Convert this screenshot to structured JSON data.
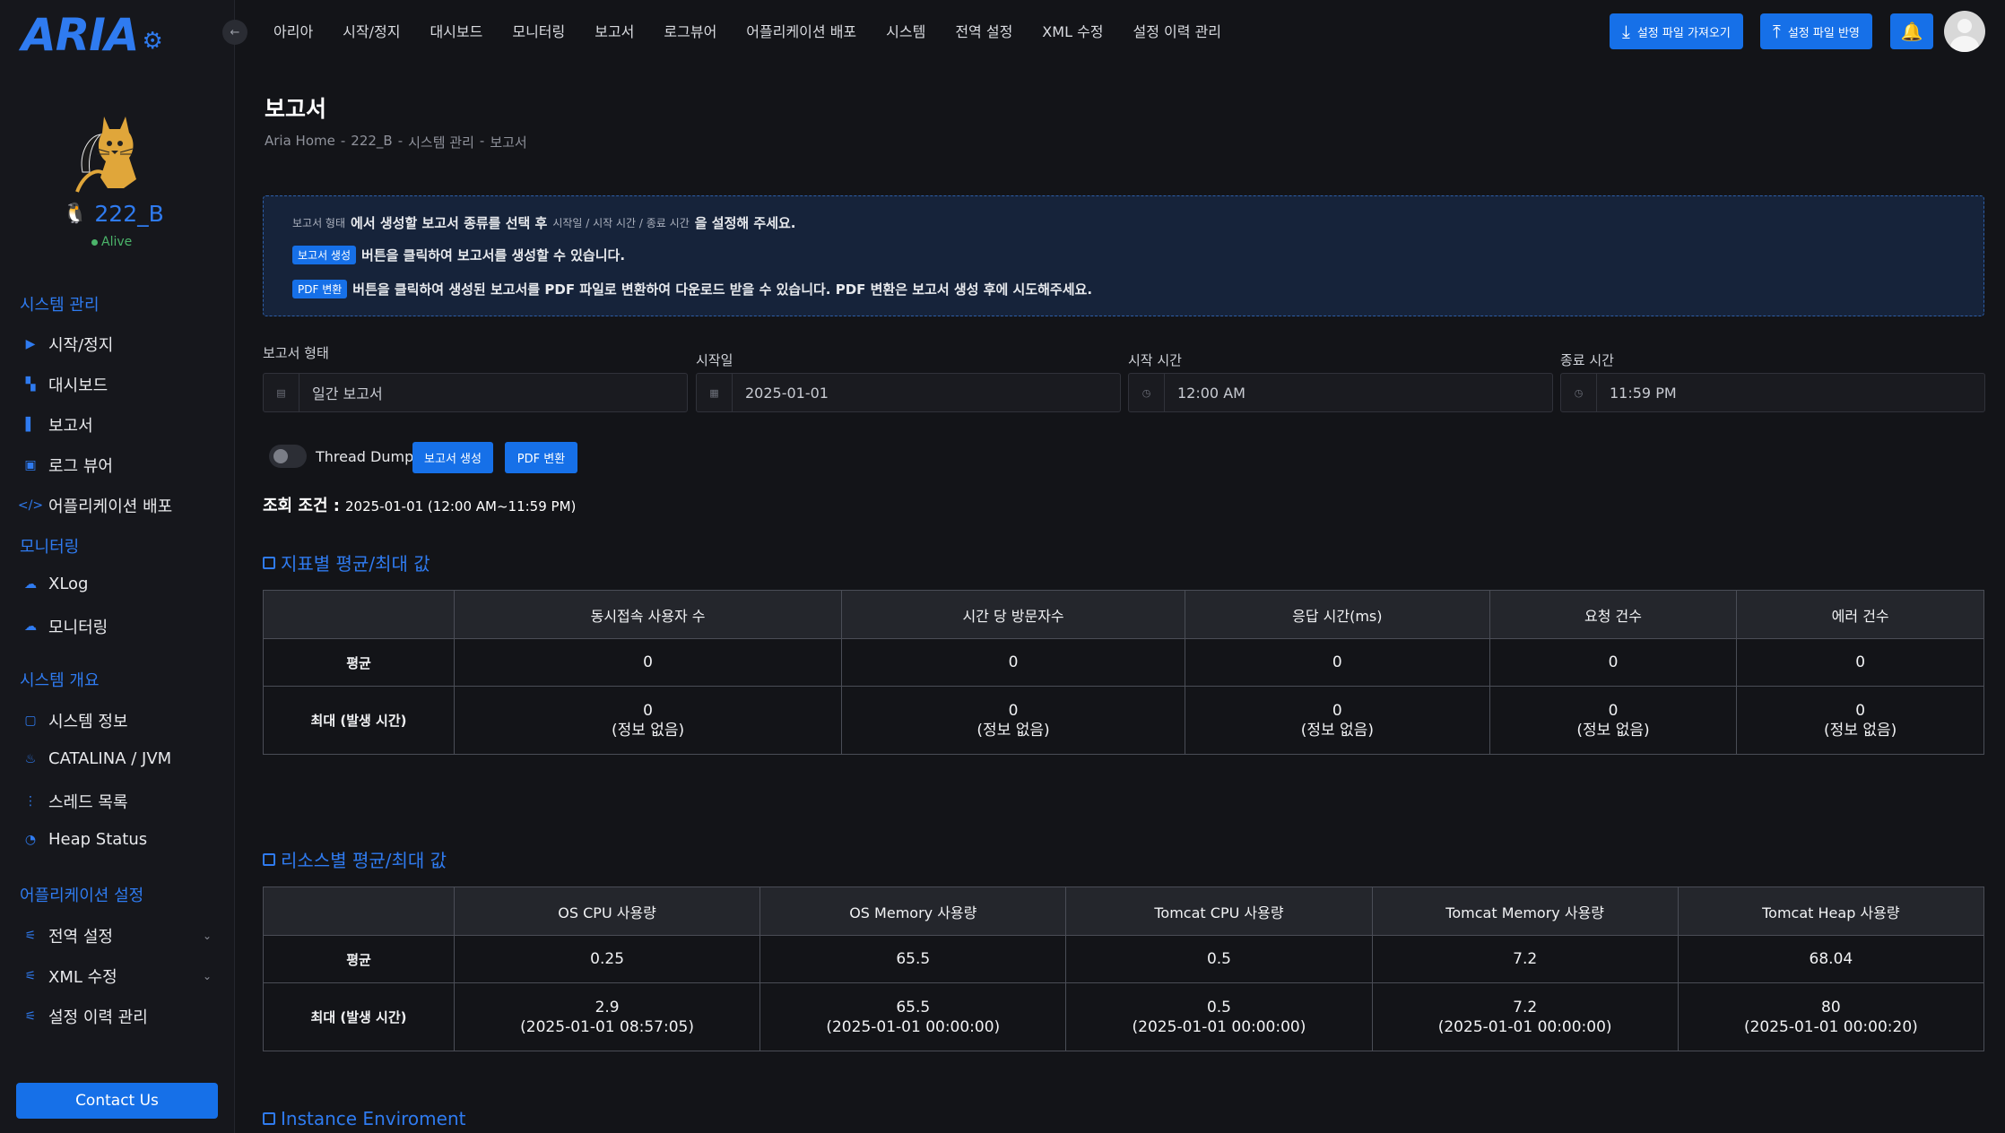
{
  "logo": {
    "text": "ARIA",
    "gear_icon": "gear-icon"
  },
  "instance": {
    "name": "222_B",
    "status": "Alive",
    "os_icon": "linux-penguin-icon"
  },
  "sidebar": {
    "sections": [
      {
        "title": "시스템 관리",
        "items": [
          {
            "label": "시작/정지",
            "icon": "play-icon"
          },
          {
            "label": "대시보드",
            "icon": "dashboard-icon"
          },
          {
            "label": "보고서",
            "icon": "report-icon"
          },
          {
            "label": "로그 뷰어",
            "icon": "log-icon"
          },
          {
            "label": "어플리케이션 배포",
            "icon": "code-icon"
          }
        ]
      },
      {
        "title": "모니터링",
        "items": [
          {
            "label": "XLog",
            "icon": "xlog-icon"
          },
          {
            "label": "모니터링",
            "icon": "monitor-icon"
          }
        ]
      },
      {
        "title": "시스템 개요",
        "items": [
          {
            "label": "시스템 정보",
            "icon": "chip-icon"
          },
          {
            "label": "CATALINA / JVM",
            "icon": "java-icon"
          },
          {
            "label": "스레드 목록",
            "icon": "thread-icon"
          },
          {
            "label": "Heap Status",
            "icon": "pie-icon"
          }
        ]
      },
      {
        "title": "어플리케이션 설정",
        "items": [
          {
            "label": "전역 설정",
            "icon": "sliders-icon"
          },
          {
            "label": "XML 수정",
            "icon": "sliders-icon"
          },
          {
            "label": "설정 이력 관리",
            "icon": "sliders-icon"
          }
        ]
      }
    ],
    "contact_label": "Contact Us"
  },
  "topnav": {
    "items": [
      "아리아",
      "시작/정지",
      "대시보드",
      "모니터링",
      "보고서",
      "로그뷰어",
      "어플리케이션 배포",
      "시스템",
      "전역 설정",
      "XML 수정",
      "설정 이력 관리"
    ],
    "import_label": "설정 파일 가져오기",
    "apply_label": "설정 파일 반영"
  },
  "page": {
    "title": "보고서",
    "breadcrumb": [
      "Aria Home",
      "222_B",
      "시스템 관리",
      "보고서"
    ]
  },
  "info": {
    "line1_a": "보고서 형태",
    "line1_b": "에서 생성할 보고서 종류를 선택 후",
    "line1_c": "시작일 / 시작 시간 / 종료 시간",
    "line1_d": "을 설정해 주세요.",
    "line2_tag": "보고서 생성",
    "line2_text": "버튼을 클릭하여 보고서를 생성할 수 있습니다.",
    "line3_tag": "PDF 변환",
    "line3_text": "버튼을 클릭하여 생성된 보고서를 PDF 파일로 변환하여 다운로드 받을 수 있습니다. PDF 변환은 보고서 생성 후에 시도해주세요."
  },
  "form": {
    "report_type_label": "보고서 형태",
    "report_type_value": "일간 보고서",
    "start_date_label": "시작일",
    "start_date_value": "2025-01-01",
    "start_time_label": "시작 시간",
    "start_time_value": "12:00 AM",
    "end_time_label": "종료 시간",
    "end_time_value": "11:59 PM",
    "thread_dump_label": "Thread Dump",
    "thread_dump_on": false,
    "generate_label": "보고서 생성",
    "pdf_label": "PDF 변환"
  },
  "query": {
    "label": "조회 조건 :",
    "value": "2025-01-01 (12:00 AM~11:59 PM)"
  },
  "metrics": {
    "title": "지표별 평균/최대 값",
    "headers": [
      "동시접속 사용자 수",
      "시간 당 방문자수",
      "응답 시간(ms)",
      "요청 건수",
      "에러 건수"
    ],
    "avg_label": "평균",
    "avg": [
      "0",
      "0",
      "0",
      "0",
      "0"
    ],
    "max_label": "최대 (발생 시간)",
    "max": [
      "0",
      "0",
      "0",
      "0",
      "0"
    ],
    "max_time": [
      "(정보 없음)",
      "(정보 없음)",
      "(정보 없음)",
      "(정보 없음)",
      "(정보 없음)"
    ]
  },
  "resources": {
    "title": "리소스별 평균/최대 값",
    "headers": [
      "OS CPU 사용량",
      "OS Memory 사용량",
      "Tomcat CPU 사용량",
      "Tomcat Memory 사용량",
      "Tomcat Heap 사용량"
    ],
    "avg_label": "평균",
    "avg": [
      "0.25",
      "65.5",
      "0.5",
      "7.2",
      "68.04"
    ],
    "max_label": "최대 (발생 시간)",
    "max": [
      "2.9",
      "65.5",
      "0.5",
      "7.2",
      "80"
    ],
    "max_time": [
      "(2025-01-01 08:57:05)",
      "(2025-01-01 00:00:00)",
      "(2025-01-01 00:00:00)",
      "(2025-01-01 00:00:00)",
      "(2025-01-01 00:00:20)"
    ]
  },
  "instance_env": {
    "title": "Instance Enviroment"
  },
  "colors": {
    "accent": "#1670e8",
    "link": "#2f7bf0",
    "alive": "#4bb46a",
    "background": "#131418"
  }
}
